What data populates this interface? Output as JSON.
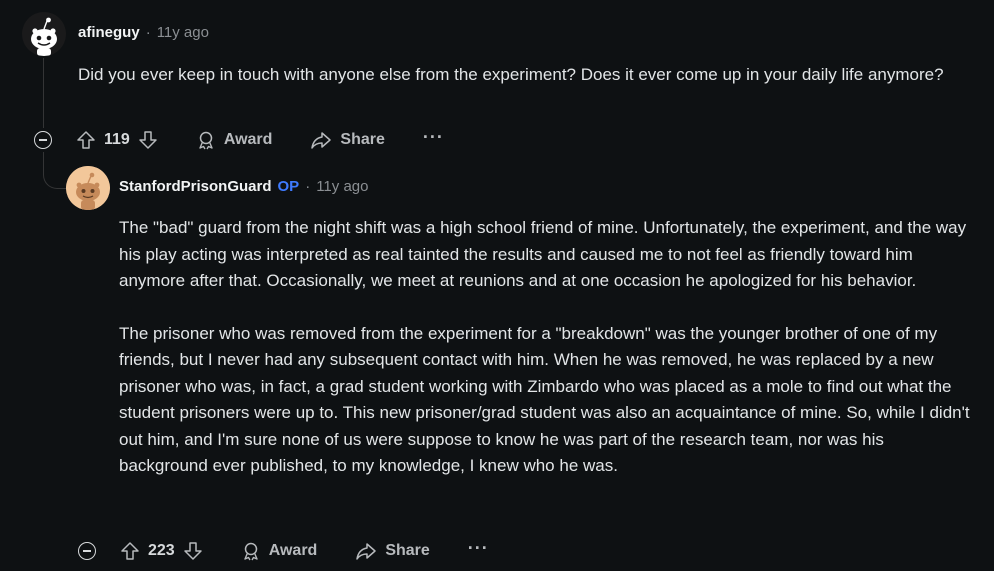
{
  "comments": [
    {
      "author": "afineguy",
      "is_op": false,
      "time": "11y ago",
      "body": [
        "Did you ever keep in touch with anyone else from the experiment? Does it ever come up in your daily life anymore?"
      ],
      "votes": "119",
      "award_label": "Award",
      "share_label": "Share",
      "more_label": "···"
    },
    {
      "author": "StanfordPrisonGuard",
      "is_op": true,
      "op_label": "OP",
      "time": "11y ago",
      "body": [
        "The \"bad\" guard from the night shift was a high school friend of mine. Unfortunately, the experiment, and the way his play acting was interpreted as real tainted the results and caused me to not feel as friendly toward him anymore after that. Occasionally, we meet at reunions and at one occasion he apologized for his behavior.",
        "The prisoner who was removed from the experiment for a \"breakdown\" was the younger brother of one of my friends, but I never had any subsequent contact with him. When he was removed, he was replaced by a new prisoner who was, in fact, a grad student working with Zimbardo who was placed as a mole to find out what the student prisoners were up to. This new prisoner/grad student was also an acquaintance of mine. So, while I didn't out him, and I'm sure none of us were suppose to know he was part of the research team, nor was his background ever published, to my knowledge, I knew who he was."
      ],
      "votes": "223",
      "award_label": "Award",
      "share_label": "Share",
      "more_label": "···"
    }
  ],
  "separator": "·",
  "colors": {
    "background": "#0e1113",
    "op_badge": "#3e7bff",
    "avatar_2_bg": "#f2c79a"
  },
  "icons": [
    "collapse-icon",
    "upvote-icon",
    "downvote-icon",
    "award-icon",
    "share-icon",
    "more-icon",
    "snoo-avatar-icon"
  ]
}
